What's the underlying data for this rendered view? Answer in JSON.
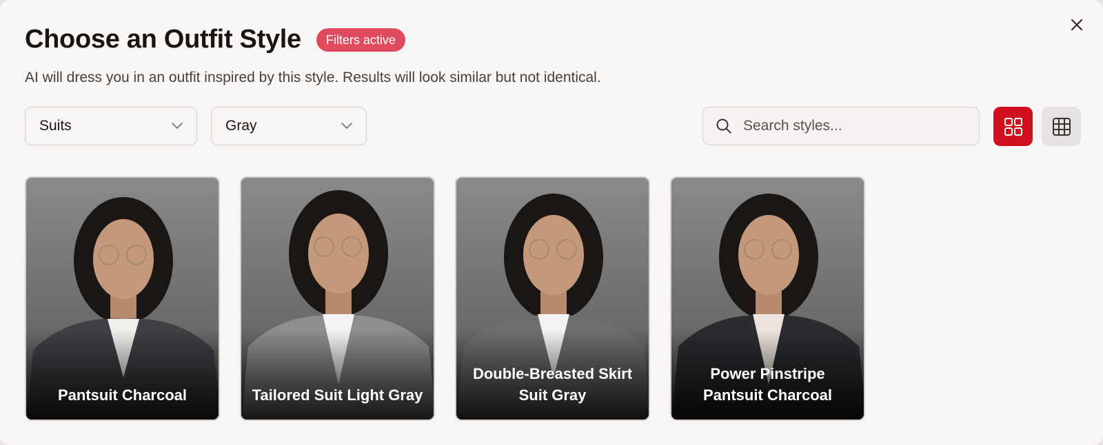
{
  "modal": {
    "title": "Choose an Outfit Style",
    "badge": "Filters active",
    "subtitle": "AI will dress you in an outfit inspired by this style. Results will look similar but not identical."
  },
  "filters": {
    "category": "Suits",
    "color": "Gray"
  },
  "search": {
    "placeholder": "Search styles..."
  },
  "view_modes": [
    "grid-large-icon",
    "grid-small-icon"
  ],
  "active_view": "grid-large",
  "colors": {
    "accent": "#d0101f",
    "badge": "#e04a5e"
  },
  "styles": [
    {
      "label": "Pantsuit Charcoal",
      "jacket": "#3f4044",
      "shirt": "#f1efec"
    },
    {
      "label": "Tailored Suit Light Gray",
      "jacket": "#8d8e90",
      "shirt": "#f4f3f1"
    },
    {
      "label": "Double-Breasted Skirt Suit Gray",
      "jacket": "#6d6e70",
      "shirt": "#f4f3f1"
    },
    {
      "label": "Power Pinstripe Pantsuit Charcoal",
      "jacket": "#2b2c30",
      "shirt": "#ece4dc"
    }
  ]
}
